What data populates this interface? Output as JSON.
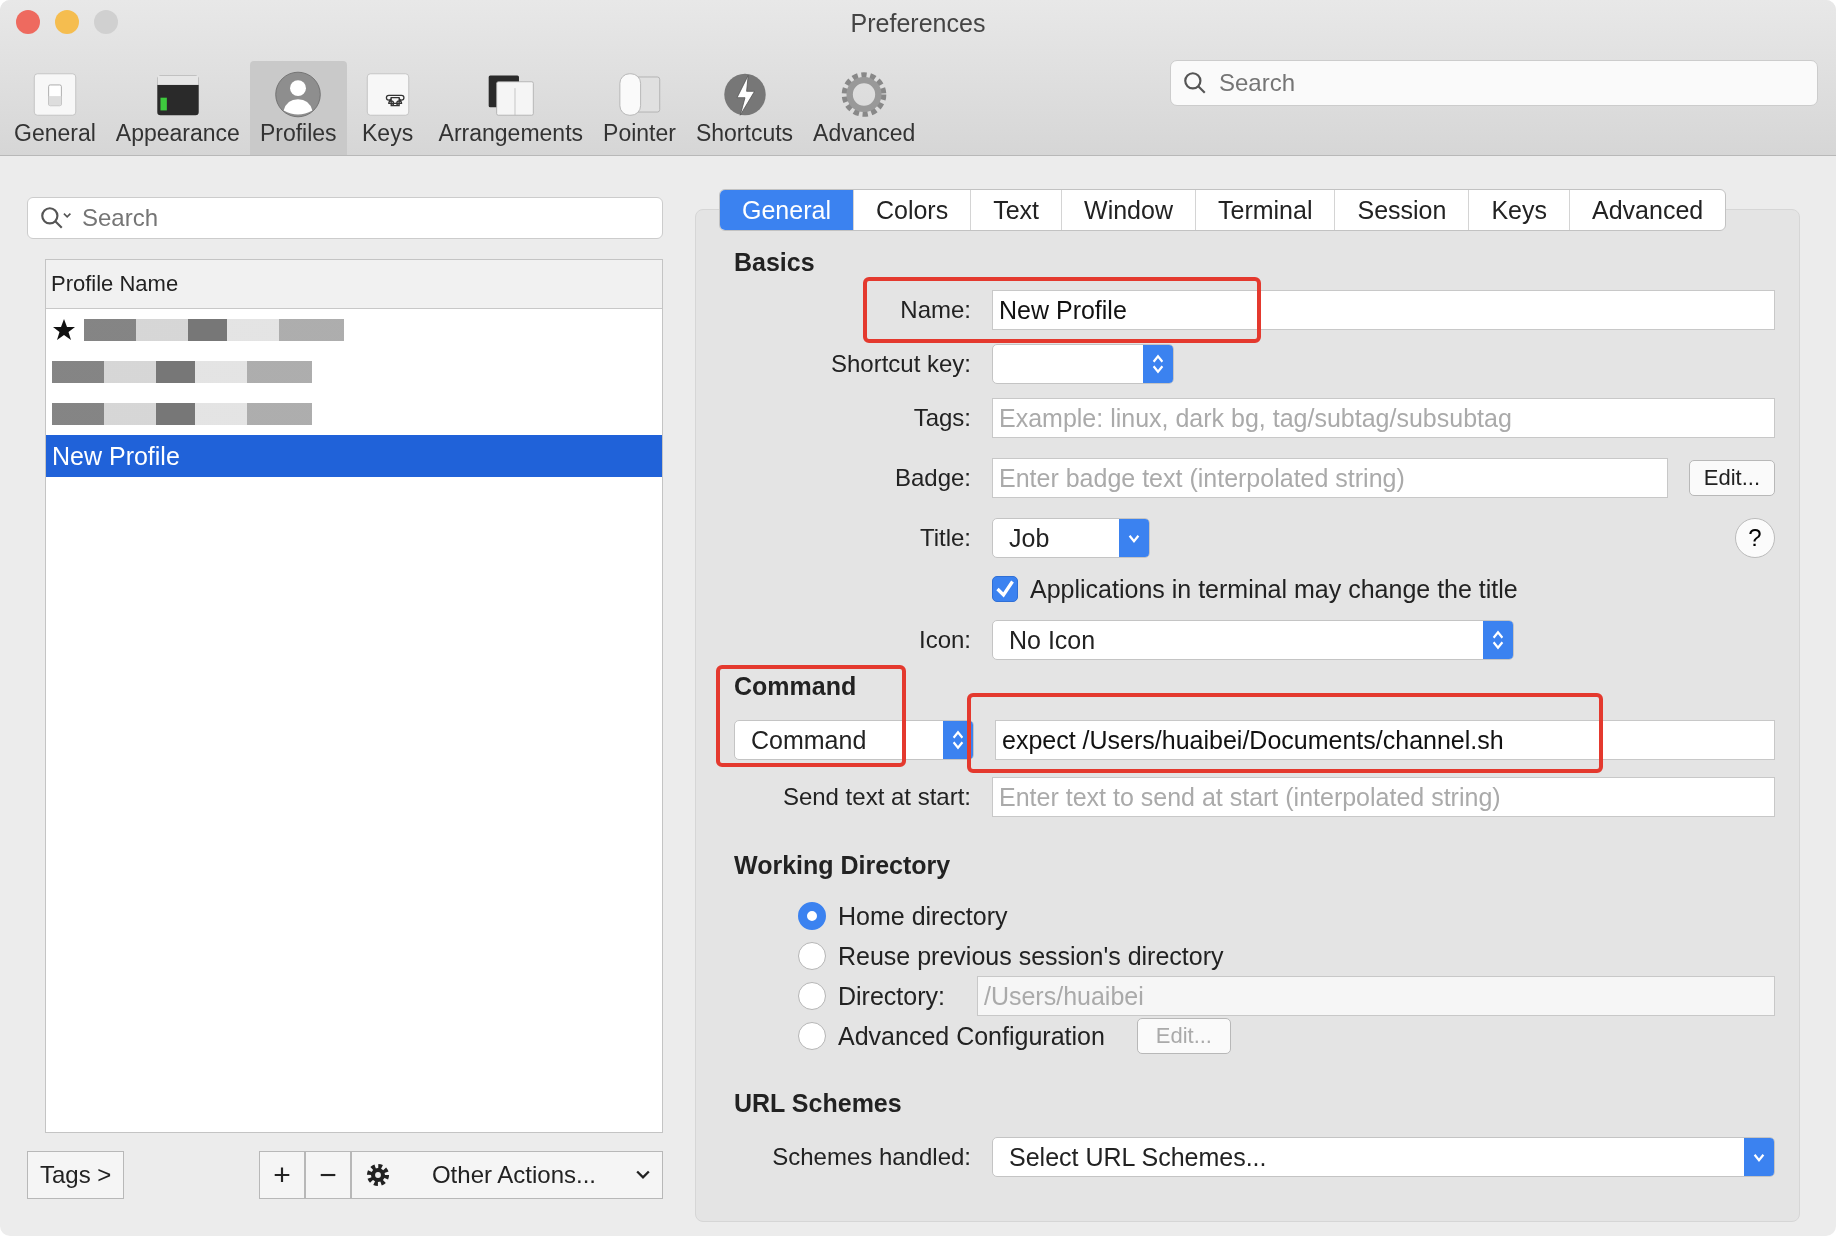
{
  "window": {
    "title": "Preferences"
  },
  "toolbar": {
    "items": [
      {
        "label": "General",
        "selected": false
      },
      {
        "label": "Appearance",
        "selected": false
      },
      {
        "label": "Profiles",
        "selected": true
      },
      {
        "label": "Keys",
        "selected": false
      },
      {
        "label": "Arrangements",
        "selected": false
      },
      {
        "label": "Pointer",
        "selected": false
      },
      {
        "label": "Shortcuts",
        "selected": false
      },
      {
        "label": "Advanced",
        "selected": false
      }
    ],
    "search": {
      "placeholder": "Search"
    }
  },
  "profiles": {
    "search": {
      "placeholder": "Search"
    },
    "column": "Profile Name",
    "rows": [
      {
        "kind": "redacted",
        "default": true,
        "selected": false
      },
      {
        "kind": "redacted",
        "default": false,
        "selected": false
      },
      {
        "kind": "redacted",
        "default": false,
        "selected": false
      },
      {
        "kind": "name",
        "name": "New Profile",
        "default": false,
        "selected": true
      }
    ],
    "tags_button": "Tags >",
    "add_button": "+",
    "remove_button": "−",
    "actions_button": "Other Actions..."
  },
  "tabs": [
    {
      "label": "General",
      "selected": true
    },
    {
      "label": "Colors",
      "selected": false
    },
    {
      "label": "Text",
      "selected": false
    },
    {
      "label": "Window",
      "selected": false
    },
    {
      "label": "Terminal",
      "selected": false
    },
    {
      "label": "Session",
      "selected": false
    },
    {
      "label": "Keys",
      "selected": false
    },
    {
      "label": "Advanced",
      "selected": false
    }
  ],
  "basics": {
    "heading": "Basics",
    "name": {
      "label": "Name:",
      "value": "New Profile",
      "highlighted": true
    },
    "shortcut": {
      "label": "Shortcut key:"
    },
    "tags": {
      "label": "Tags:",
      "placeholder": "Example: linux, dark bg, tag/subtag/subsubtag"
    },
    "badge": {
      "label": "Badge:",
      "placeholder": "Enter badge text (interpolated string)",
      "button": "Edit..."
    },
    "title": {
      "label": "Title:",
      "value": "Job",
      "help": "?"
    },
    "title_checkbox": {
      "label": "Applications in terminal may change the title",
      "checked": true
    },
    "icon": {
      "label": "Icon:",
      "value": "No Icon"
    }
  },
  "command": {
    "heading": "Command",
    "highlighted": true,
    "mode": "Command",
    "value": "expect /Users/huaibei/Documents/channel.sh",
    "value_highlighted": true,
    "send_text": {
      "label": "Send text at start:",
      "placeholder": "Enter text to send at start (interpolated string)"
    }
  },
  "working_directory": {
    "heading": "Working Directory",
    "options": [
      {
        "kind": "plain",
        "label": "Home directory",
        "selected": true
      },
      {
        "kind": "plain",
        "label": "Reuse previous session's directory",
        "selected": false
      },
      {
        "kind": "path",
        "label": "Directory:",
        "placeholder": "/Users/huaibei",
        "selected": false
      },
      {
        "kind": "edit",
        "label": "Advanced Configuration",
        "button": "Edit...",
        "selected": false
      }
    ]
  },
  "url_schemes": {
    "heading": "URL Schemes",
    "label": "Schemes handled:",
    "value": "Select URL Schemes..."
  }
}
